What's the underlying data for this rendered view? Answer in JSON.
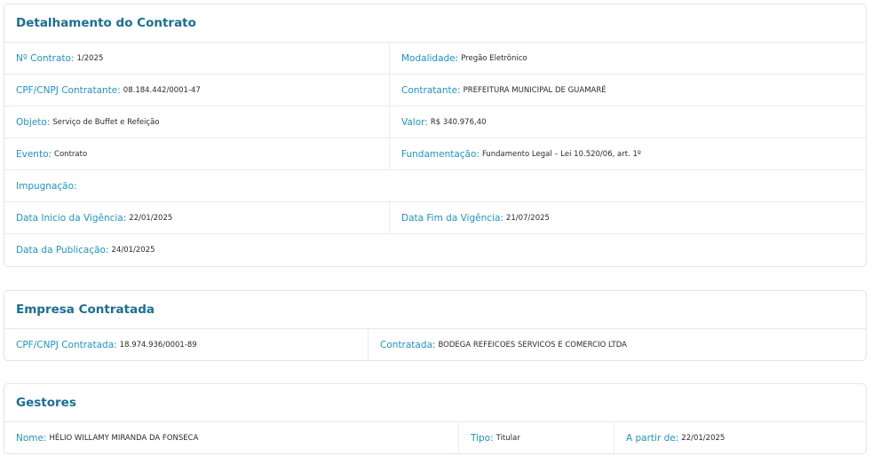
{
  "contrato": {
    "title": "Detalhamento do Contrato",
    "numero": {
      "label": "Nº Contrato:",
      "value": "1/2025"
    },
    "modalidade": {
      "label": "Modalidade:",
      "value": "Pregão Eletrônico"
    },
    "cpf_cnpj_contratante": {
      "label": "CPF/CNPJ Contratante:",
      "value": "08.184.442/0001-47"
    },
    "contratante": {
      "label": "Contratante:",
      "value": "PREFEITURA MUNICIPAL DE GUAMARÉ"
    },
    "objeto": {
      "label": "Objeto:",
      "value": "Serviço de Buffet e Refeição"
    },
    "valor": {
      "label": "Valor:",
      "value": "R$ 340.976,40"
    },
    "evento": {
      "label": "Evento:",
      "value": "Contrato"
    },
    "fundamentacao": {
      "label": "Fundamentação:",
      "value": "Fundamento Legal – Lei 10.520/06, art. 1º"
    },
    "impugnacao": {
      "label": "Impugnação:",
      "value": ""
    },
    "data_inicio": {
      "label": "Data Inicio da Vigência:",
      "value": "22/01/2025"
    },
    "data_fim": {
      "label": "Data Fim da Vigência:",
      "value": "21/07/2025"
    },
    "data_publicacao": {
      "label": "Data da Publicação:",
      "value": "24/01/2025"
    }
  },
  "empresa": {
    "title": "Empresa Contratada",
    "cpf_cnpj_contratada": {
      "label": "CPF/CNPJ Contratada:",
      "value": "18.974.936/0001-89"
    },
    "contratada": {
      "label": "Contratada:",
      "value": "BODEGA REFEICOES SERVICOS E COMERCIO LTDA"
    }
  },
  "gestores": {
    "title": "Gestores",
    "nome": {
      "label": "Nome:",
      "value": "HÉLIO WILLAMY MIRANDA DA FONSECA"
    },
    "tipo": {
      "label": "Tipo:",
      "value": "Titular"
    },
    "a_partir_de": {
      "label": "A partir de:",
      "value": "22/01/2025"
    }
  },
  "colors": {
    "heading": "#1a6f94",
    "label": "#1e93c7",
    "border": "#e1e4e8"
  }
}
